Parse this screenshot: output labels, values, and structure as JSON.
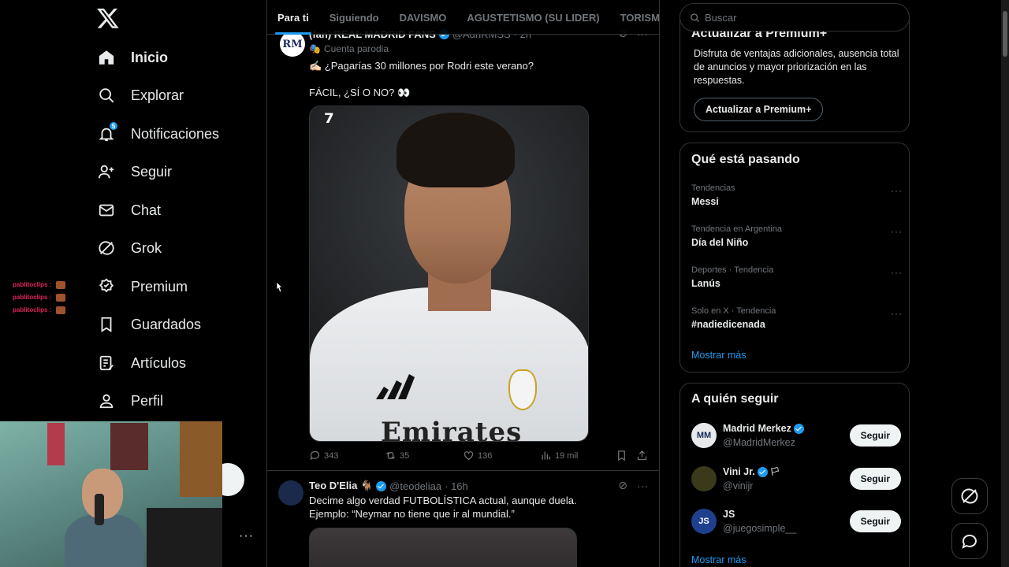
{
  "nav": {
    "items": [
      {
        "label": "Inicio",
        "icon": "home-icon",
        "active": true
      },
      {
        "label": "Explorar",
        "icon": "search-icon"
      },
      {
        "label": "Notificaciones",
        "icon": "bell-icon",
        "badge": "5"
      },
      {
        "label": "Seguir",
        "icon": "add-person-icon"
      },
      {
        "label": "Chat",
        "icon": "mail-icon"
      },
      {
        "label": "Grok",
        "icon": "grok-icon"
      },
      {
        "label": "Premium",
        "icon": "premium-icon"
      },
      {
        "label": "Guardados",
        "icon": "bookmark-icon"
      },
      {
        "label": "Artículos",
        "icon": "articles-icon"
      },
      {
        "label": "Perfil",
        "icon": "person-icon"
      }
    ],
    "more": "···"
  },
  "stream_chat": {
    "lines": [
      "pablitoclips :",
      "pablitoclips :",
      "pablitoclips :"
    ]
  },
  "feed": {
    "tabs": [
      "Para ti",
      "Siguiendo",
      "DAVISMO",
      "AGUSTETISMO (SU LIDER)",
      "TORISMO"
    ],
    "active_tab": "Para ti",
    "post1": {
      "avatar_text": "RM",
      "name": "(fan) REAL MADRID FANS",
      "handle": "@AdnRMSS",
      "time": "· 2h",
      "parody_label": "Cuenta parodia",
      "text_line1": "✍🏻 ¿Pagarías 30 millones por Rodri este verano?",
      "text_line2": "FÁCIL, ¿SÍ O NO? 👀",
      "media_sponsor": "Emirates",
      "replies": "343",
      "reposts": "35",
      "likes": "136",
      "views": "19 mil"
    },
    "post2": {
      "name": "Teo D'Elia 🐐",
      "handle": "@teodeliaa",
      "time": "· 16h",
      "text_line1": "Decime algo verdad FUTBOLÍSTICA actual, aunque duela.",
      "text_line2": "Ejemplo: “Neymar no tiene que ir al mundial.”"
    }
  },
  "right": {
    "search_placeholder": "Buscar",
    "premium": {
      "title": "Actualizar a Premium+",
      "text": "Disfruta de ventajas adicionales, ausencia total de anuncios y mayor priorización en las respuestas.",
      "button": "Actualizar a Premium+"
    },
    "trends": {
      "title": "Qué está pasando",
      "items": [
        {
          "meta": "Tendencias",
          "name": "Messi"
        },
        {
          "meta": "Tendencia en Argentina",
          "name": "Día del Niño"
        },
        {
          "meta": "Deportes · Tendencia",
          "name": "Lanús"
        },
        {
          "meta": "Solo en X · Tendencia",
          "name": "#nadiedicenada"
        }
      ],
      "show_more": "Mostrar más"
    },
    "who_to_follow": {
      "title": "A quién seguir",
      "items": [
        {
          "name": "Madrid Merkez",
          "handle": "@MadridMerkez",
          "button": "Seguir",
          "avatar_text": "MM",
          "avatar_color": "#e7e9ea"
        },
        {
          "name": "Vini Jr.",
          "handle": "@vinijr",
          "button": "Seguir",
          "avatar_text": "",
          "avatar_color": "#3a3a1a"
        },
        {
          "name": "JS",
          "handle": "@juegosimple__",
          "button": "Seguir",
          "avatar_text": "JS",
          "avatar_color": "#1f3f8f"
        }
      ],
      "show_more": "Mostrar más"
    }
  },
  "colors": {
    "accent": "#1d9bf0",
    "background": "#000000",
    "border": "#2f3336",
    "muted": "#71767b"
  }
}
